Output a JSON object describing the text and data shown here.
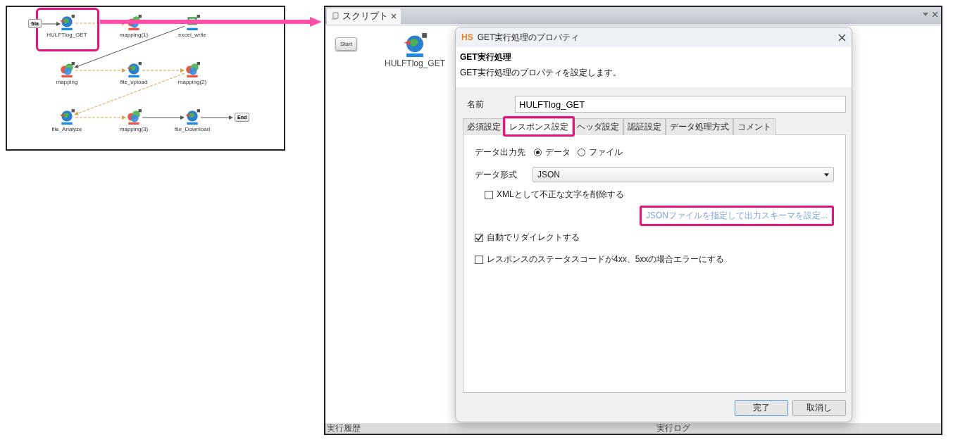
{
  "diagram": {
    "start": {
      "label": "Sta"
    },
    "end": {
      "label": "End"
    },
    "nodes": [
      {
        "label": "HULFTlog_GET",
        "kind": "rest",
        "highlighted": true
      },
      {
        "label": "mapping(1)",
        "kind": "mapper",
        "highlighted": false
      },
      {
        "label": "excel_write",
        "kind": "excel",
        "highlighted": false
      },
      {
        "label": "mapping",
        "kind": "mapper",
        "highlighted": false
      },
      {
        "label": "file_upload",
        "kind": "rest",
        "highlighted": false
      },
      {
        "label": "mapping(2)",
        "kind": "mapper",
        "highlighted": false
      },
      {
        "label": "file_Analyze",
        "kind": "rest",
        "highlighted": false
      },
      {
        "label": "mapping(3)",
        "kind": "mapper",
        "highlighted": false
      },
      {
        "label": "file_Download",
        "kind": "rest",
        "highlighted": false
      }
    ]
  },
  "editor": {
    "tabs": [
      {
        "label": "スクリプト",
        "selected": true
      }
    ],
    "start_label": "Start",
    "node": {
      "label": "HULFTlog_GET",
      "kind": "rest"
    },
    "bottom_left": "実行履歴",
    "bottom_right": "実行ログ"
  },
  "dialog": {
    "logo": "HS",
    "title": "GET実行処理のプロパティ",
    "heading": "GET実行処理",
    "description": "GET実行処理のプロパティを設定します。",
    "name_label": "名前",
    "name_value": "HULFTlog_GET",
    "tabs": [
      {
        "label": "必須設定",
        "selected": false,
        "highlighted": false
      },
      {
        "label": "レスポンス設定",
        "selected": true,
        "highlighted": true
      },
      {
        "label": "ヘッダ設定",
        "selected": false,
        "highlighted": false
      },
      {
        "label": "認証設定",
        "selected": false,
        "highlighted": false
      },
      {
        "label": "データ処理方式",
        "selected": false,
        "highlighted": false
      },
      {
        "label": "コメント",
        "selected": false,
        "highlighted": false
      }
    ],
    "output": {
      "label": "データ出力先",
      "options": [
        {
          "label": "データ",
          "selected": true
        },
        {
          "label": "ファイル",
          "selected": false
        }
      ]
    },
    "format": {
      "label": "データ形式",
      "value": "JSON"
    },
    "xml_check": {
      "label": "XMLとして不正な文字を削除する",
      "checked": false
    },
    "schema_link": {
      "label": "JSONファイルを指定して出力スキーマを設定...",
      "highlighted": true
    },
    "checks": [
      {
        "label": "自動でリダイレクトする",
        "checked": true
      },
      {
        "label": "レスポンスのステータスコードが4xx、5xxの場合エラーにする",
        "checked": false
      }
    ],
    "buttons": [
      {
        "label": "完了",
        "kind": "primary"
      },
      {
        "label": "取消し",
        "kind": "normal"
      }
    ]
  }
}
